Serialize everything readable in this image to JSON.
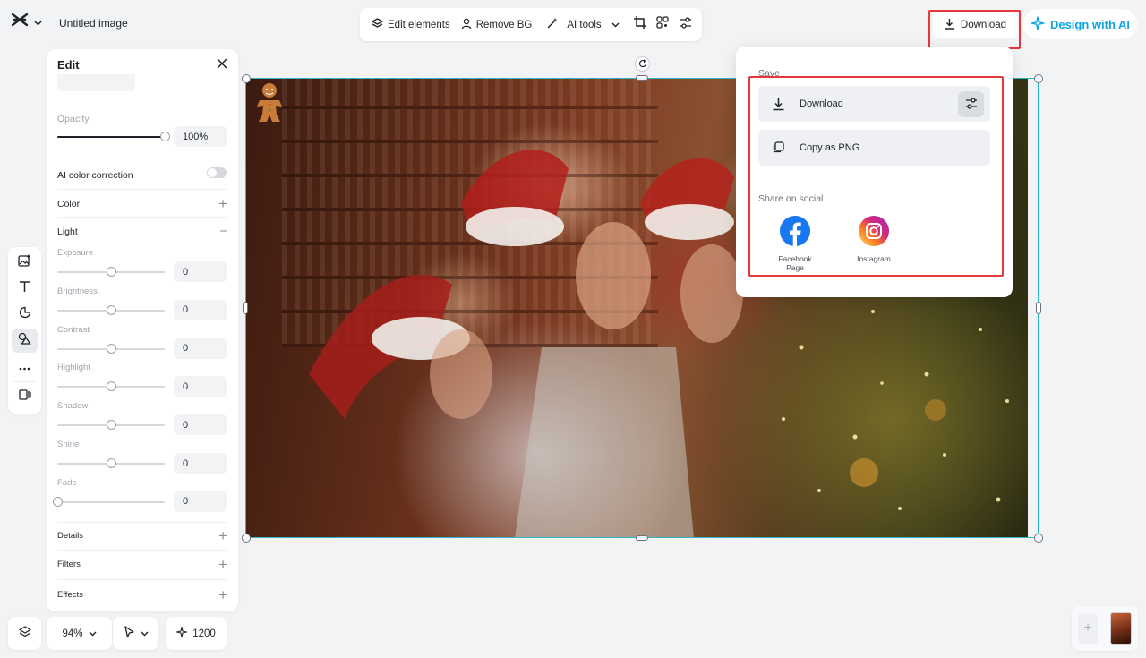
{
  "header": {
    "title": "Untitled image",
    "toolbar": {
      "edit_elements": "Edit elements",
      "remove_bg": "Remove BG",
      "ai_tools": "AI tools"
    },
    "download_label": "Download",
    "design_ai_label": "Design with AI"
  },
  "edit_panel": {
    "title": "Edit",
    "opacity": {
      "label": "Opacity",
      "value": "100%",
      "level": 1.0
    },
    "ai_color_correction": {
      "label": "AI color correction",
      "enabled": false
    },
    "color_label": "Color",
    "light": {
      "label": "Light",
      "sliders": [
        {
          "label": "Exposure",
          "value": "0",
          "level": 0.5
        },
        {
          "label": "Brightness",
          "value": "0",
          "level": 0.5
        },
        {
          "label": "Contrast",
          "value": "0",
          "level": 0.5
        },
        {
          "label": "Highlight",
          "value": "0",
          "level": 0.5
        },
        {
          "label": "Shadow",
          "value": "0",
          "level": 0.5
        },
        {
          "label": "Shine",
          "value": "0",
          "level": 0.5
        },
        {
          "label": "Fade",
          "value": "0",
          "level": 0.0
        }
      ]
    },
    "details_label": "Details",
    "filters_label": "Filters",
    "effects_label": "Effects"
  },
  "download_popover": {
    "save_heading": "Save",
    "download_option": "Download",
    "copy_option": "Copy as PNG",
    "share_heading": "Share on social",
    "social": [
      {
        "label": "Facebook\nPage",
        "icon": "facebook-icon",
        "color": "#1877f2"
      },
      {
        "label": "Instagram",
        "icon": "instagram-icon",
        "color": "#e1306c"
      }
    ]
  },
  "bottom_bar": {
    "zoom": "94%",
    "credits": "1200"
  },
  "colors": {
    "accent": "#11a3e0",
    "highlight_outline": "#e5383b",
    "selection": "#2eb7c9"
  }
}
